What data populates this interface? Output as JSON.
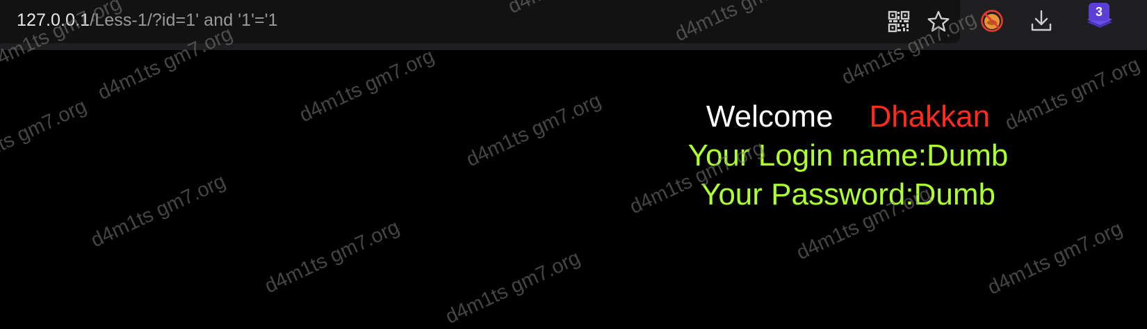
{
  "address_bar": {
    "url_host": "127.0.0.1",
    "url_path": "/Less-1/?id=1' and '1'='1"
  },
  "toolbar": {
    "icons": [
      "qr-code-icon",
      "star-icon",
      "extension-icon",
      "download-icon",
      "layers-icon"
    ],
    "badge_count": "3",
    "accent": "#5b3fd6"
  },
  "page": {
    "welcome_word": "Welcome",
    "welcome_name": "Dhakkan",
    "login_line": "Your Login name:Dumb",
    "password_line": "Your Password:Dumb",
    "colors": {
      "background": "#000000",
      "welcome": "#ffffff",
      "name": "#ff2c1e",
      "info": "#adff2f"
    }
  },
  "watermark_text": "d4m1ts gm7.org"
}
